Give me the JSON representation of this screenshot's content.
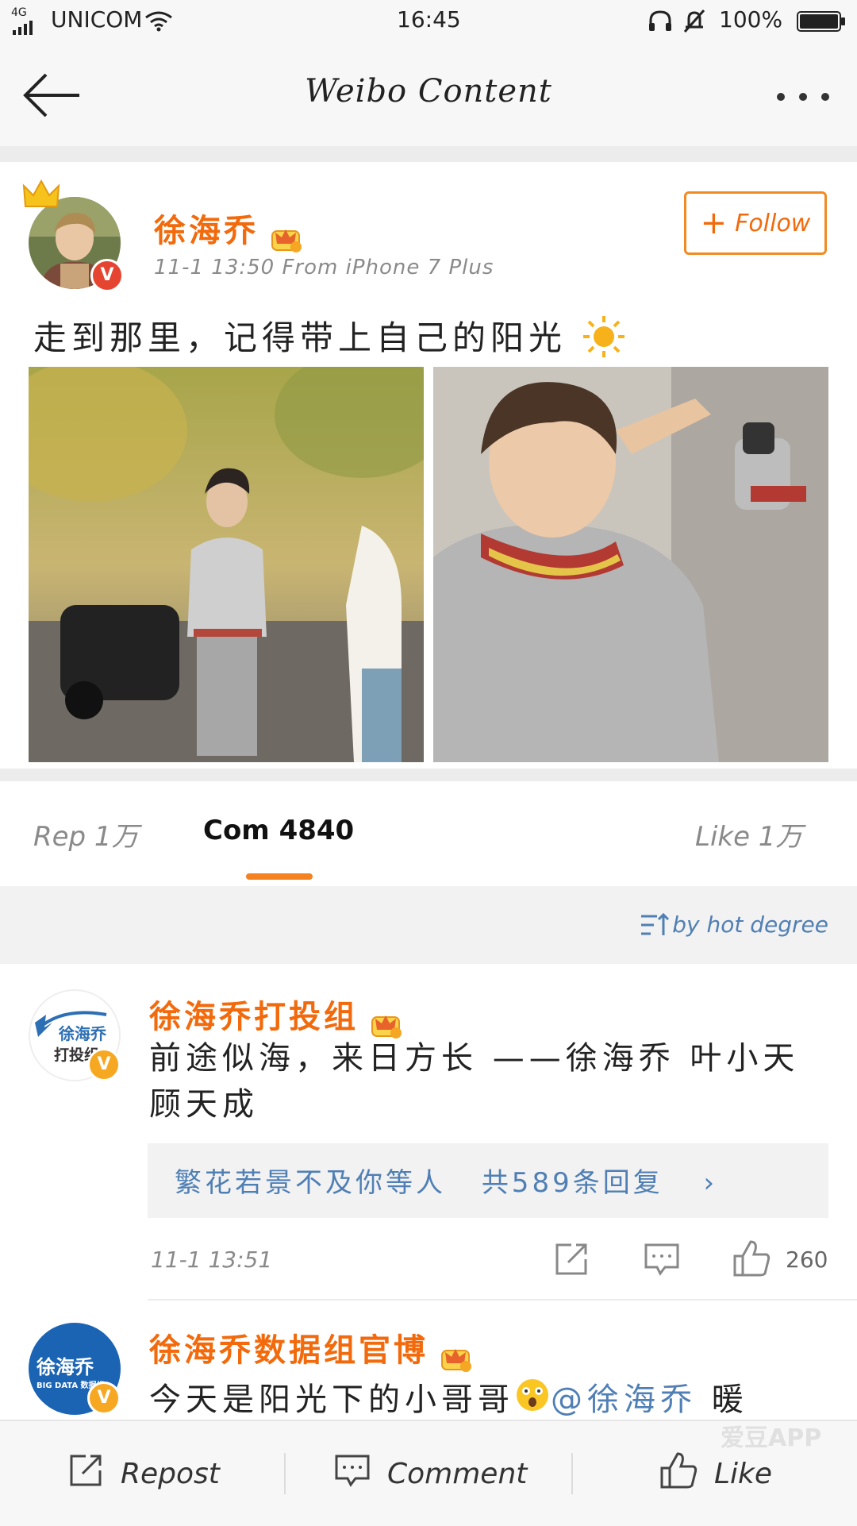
{
  "status_bar": {
    "network": "4G",
    "carrier": "UNICOM",
    "time": "16:45",
    "battery": "100%"
  },
  "nav": {
    "title": "Weibo Content"
  },
  "post": {
    "author": "徐海乔",
    "meta": "11-1 13:50  From iPhone 7 Plus",
    "follow_label": "Follow",
    "text": "走到那里，记得带上自己的阳光"
  },
  "tabs": {
    "repost": "Rep  1万",
    "comment": "Com  4840",
    "like": "Like  1万"
  },
  "sort_label": "by hot degree",
  "comments": [
    {
      "author": "徐海乔打投组",
      "avatar_text_1": "徐海乔",
      "avatar_text_2": "打投组",
      "text": "前途似海，来日方长 ——徐海乔 叶小天 顾天成",
      "reply_preview": "繁花若景不及你等人",
      "reply_count": "共589条回复",
      "time": "11-1 13:51",
      "likes": "260"
    },
    {
      "author": "徐海乔数据组官博",
      "avatar_text_1": "徐海乔",
      "avatar_text_2": "BIG DATA 数据组",
      "text_before": "今天是阳光下的小哥哥",
      "mention": "@徐海乔",
      "text_after": " 暖"
    }
  ],
  "bottom_bar": {
    "repost": "Repost",
    "comment": "Comment",
    "like": "Like"
  },
  "watermark": "爱豆APP"
}
